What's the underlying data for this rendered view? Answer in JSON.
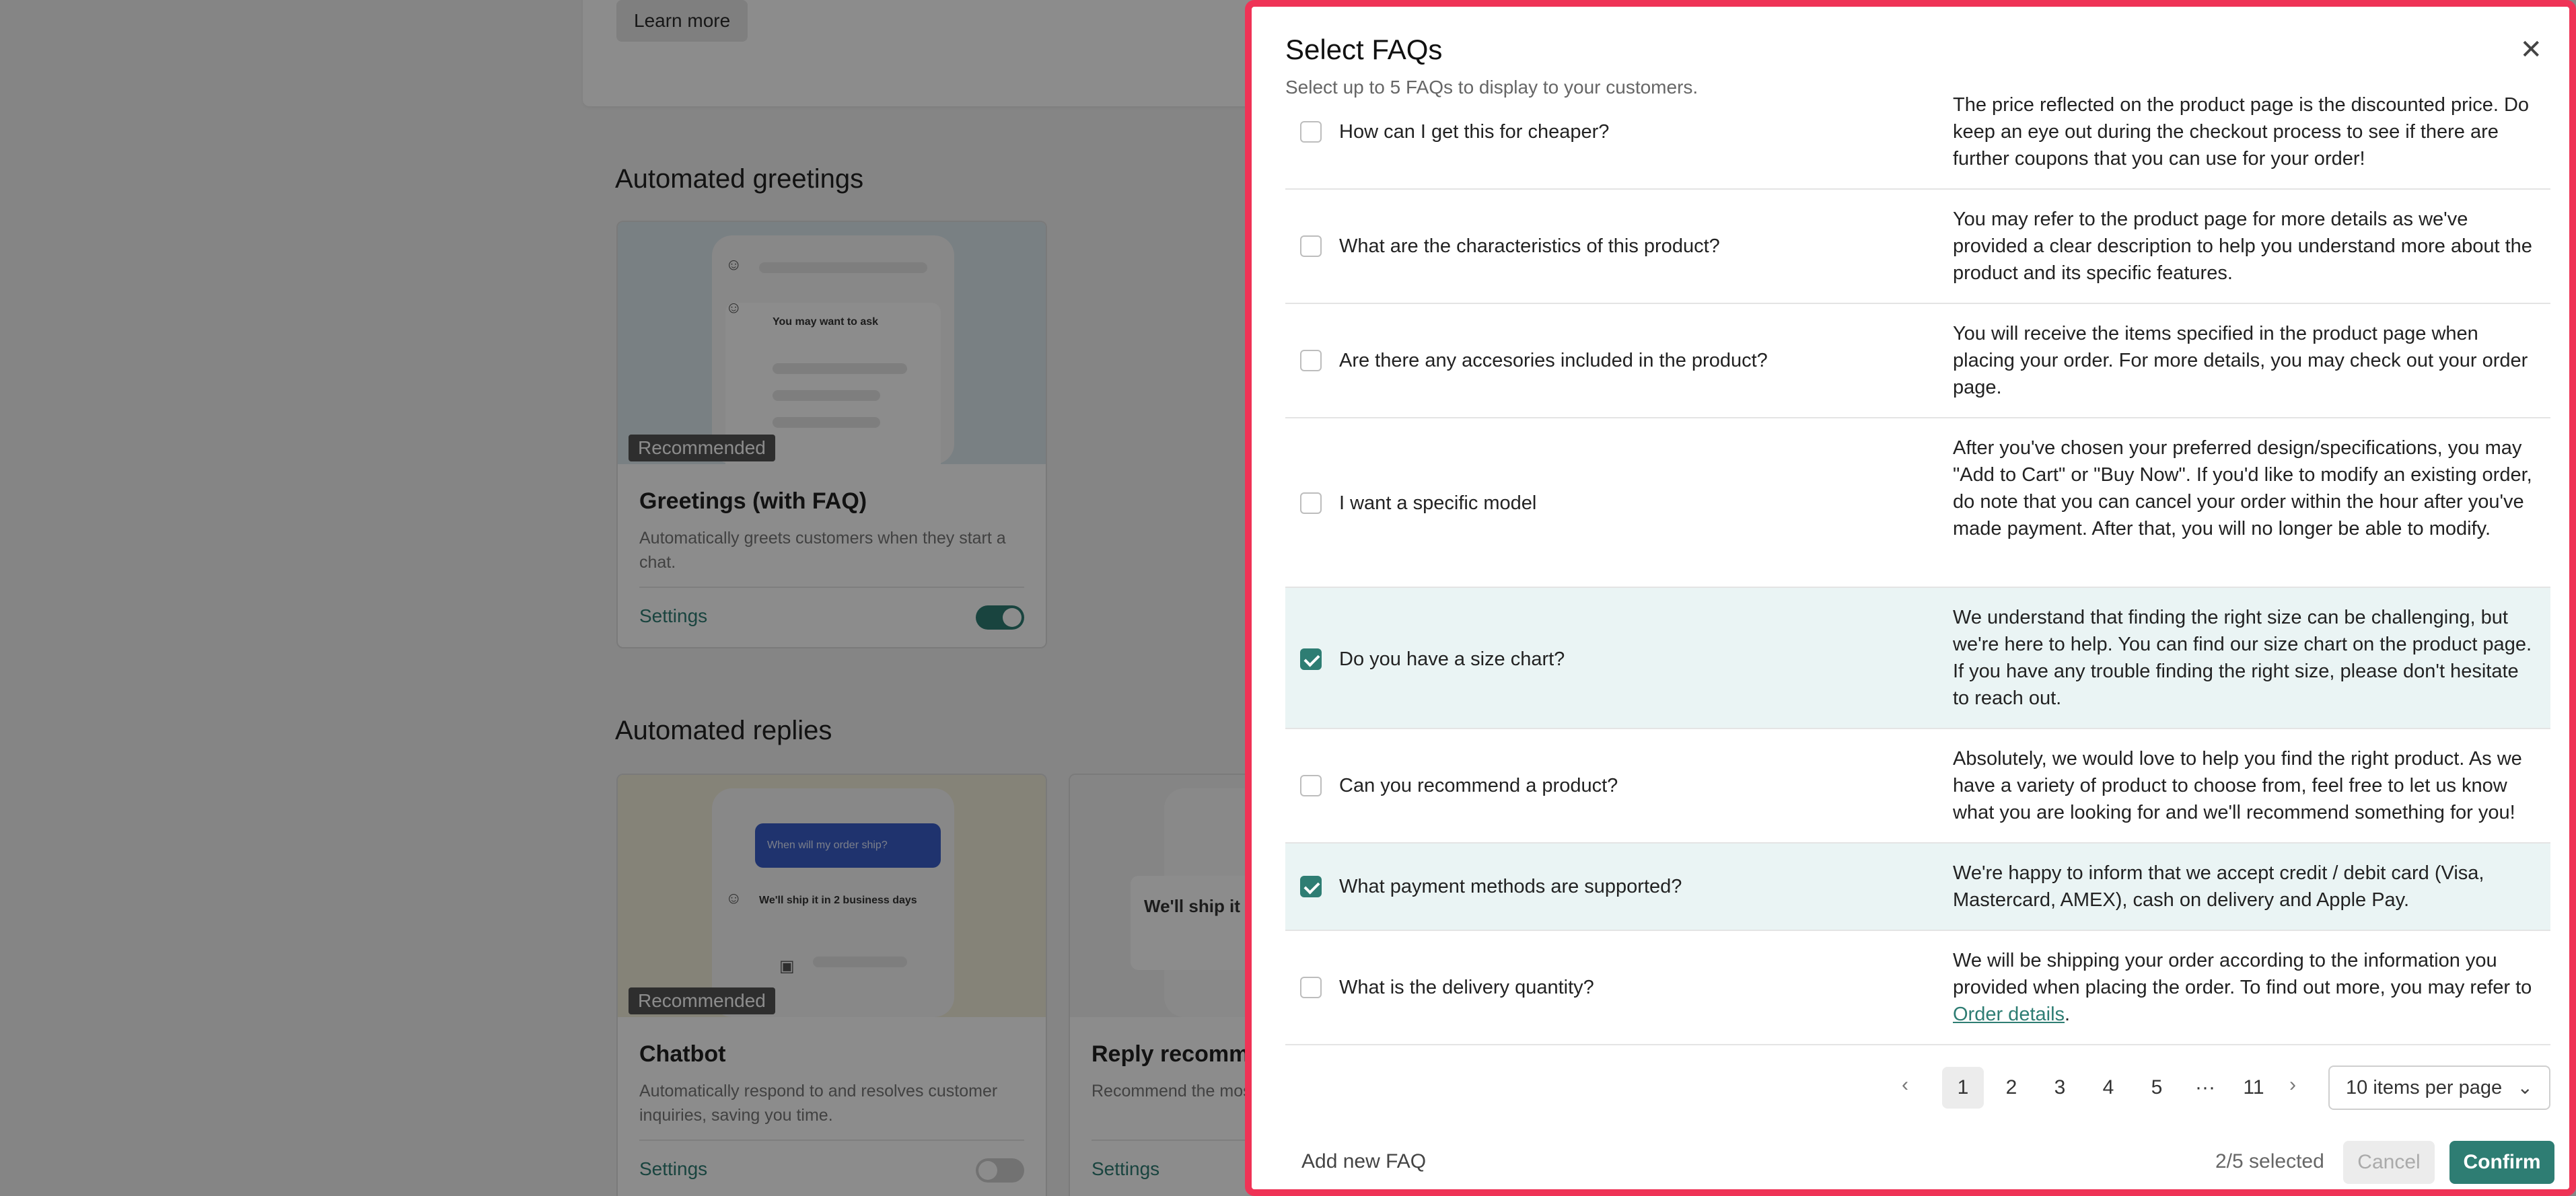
{
  "background": {
    "learn_more_label": "Learn more",
    "greetings_section_title": "Automated greetings",
    "replies_section_title": "Automated replies",
    "greetings_card": {
      "preview_text": "You may want to ask",
      "badge": "Recommended",
      "title": "Greetings (with FAQ)",
      "description": "Automatically greets customers when they start a chat.",
      "settings_label": "Settings",
      "toggle_on": true
    },
    "chatbot_card": {
      "preview_question": "When will my order ship?",
      "preview_answer": "We'll ship it in 2 business days",
      "badge": "Recommended",
      "title": "Chatbot",
      "description": "Automatically respond to and resolves customer inquiries, saving you time.",
      "settings_label": "Settings",
      "toggle_on": false
    },
    "reply_card": {
      "preview_text": "We'll ship it in",
      "title": "Reply recomme",
      "description": "Recommend the mos customer inquiries, b",
      "settings_label": "Settings"
    }
  },
  "drawer": {
    "title": "Select FAQs",
    "subtitle": "Select up to 5 FAQs to display to your customers.",
    "close_icon": "close-icon",
    "faqs": [
      {
        "question": "How can I get this for cheaper?",
        "answer": "The price reflected on the product page is the discounted price. Do keep an eye out during the checkout process to see if there are further coupons that you can use for your order!",
        "checked": false
      },
      {
        "question": "What are the characteristics of this product?",
        "answer": "You may refer to the product page for more details as we've provided a clear description to help you understand more about the product and its specific features.",
        "checked": false
      },
      {
        "question": "Are there any accesories included in the product?",
        "answer": "You will receive the items specified in the product page when placing your order. For more details, you may check out your order page.",
        "checked": false
      },
      {
        "question": "I want a specific model",
        "answer": "After you've chosen your preferred design/specifications, you may \"Add to Cart\" or \"Buy Now\". If you'd like to modify an existing order, do note that you can cancel your order within the hour after you've made payment. After that, you will no longer be able to modify.",
        "checked": false
      },
      {
        "question": "Do you have a size chart?",
        "answer": "We understand that finding the right size can be challenging, but we're here to help. You can find our size chart on the product page. If you have any trouble finding the right size, please don't hesitate to reach out.",
        "checked": true
      },
      {
        "question": "Can you recommend a product?",
        "answer": "Absolutely, we would love to help you find the right product. As we have a variety of product to choose from, feel free to let us know what you are looking for and we'll recommend something for you!",
        "checked": false
      },
      {
        "question": "What payment methods are supported?",
        "answer": "We're happy to inform that we accept credit / debit card (Visa, Mastercard, AMEX), cash on delivery and Apple Pay.",
        "checked": true
      },
      {
        "question": "What is the delivery quantity?",
        "answer": "We will be shipping your order according to the information you provided when placing the order. To find out more, you may refer to ",
        "answer_link": "Order details",
        "answer_end": ".",
        "checked": false
      }
    ],
    "pagination": {
      "pages": [
        "1",
        "2",
        "3",
        "4",
        "5",
        "···",
        "11"
      ],
      "current": "1",
      "per_page": "10 items per page"
    },
    "footer": {
      "add_new": "Add new FAQ",
      "selected_count": "2/5 selected",
      "cancel_label": "Cancel",
      "confirm_label": "Confirm"
    }
  },
  "colors": {
    "accent": "#2e7d73",
    "highlight_border": "#ef3356",
    "selected_row": "#eaf4f4"
  }
}
